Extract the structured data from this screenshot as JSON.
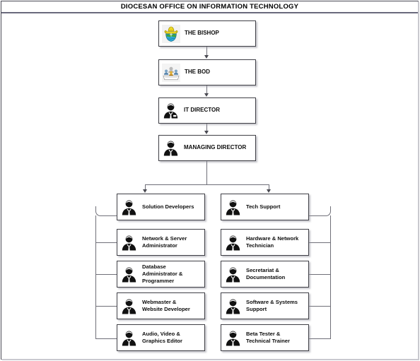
{
  "document": {
    "title": "DIOCESAN OFFICE ON INFORMATION TECHNOLOGY"
  },
  "chain": [
    {
      "id": "bishop",
      "label": "THE BISHOP",
      "icon": "bishop-crest-icon"
    },
    {
      "id": "bod",
      "label": "THE BOD",
      "icon": "board-meeting-icon"
    },
    {
      "id": "itdir",
      "label": "IT DIRECTOR",
      "icon": "person-icon"
    },
    {
      "id": "mdir",
      "label": "MANAGING DIRECTOR",
      "icon": "person-icon"
    }
  ],
  "columns": {
    "left": {
      "head": {
        "label": "Solution Developers",
        "icon": "person-icon"
      },
      "items": [
        {
          "label": "Network & Server\nAdministrator",
          "icon": "person-icon"
        },
        {
          "label": "Database\nAdministrator &\nProgrammer",
          "icon": "person-icon"
        },
        {
          "label": "Webmaster &\nWebsite Developer",
          "icon": "person-icon"
        },
        {
          "label": "Audio, Video &\nGraphics Editor",
          "icon": "person-icon"
        }
      ]
    },
    "right": {
      "head": {
        "label": "Tech Support",
        "icon": "person-icon"
      },
      "items": [
        {
          "label": "Hardware & Network\nTechnician",
          "icon": "person-icon"
        },
        {
          "label": "Secretariat &\nDocumentation",
          "icon": "person-icon"
        },
        {
          "label": "Software & Systems\nSupport",
          "icon": "person-icon"
        },
        {
          "label": "Beta Tester &\nTechnical Trainer",
          "icon": "person-icon"
        }
      ]
    }
  },
  "colors": {
    "frame_border": "#4a4a55",
    "title_rule": "#6a6a7d",
    "node_border": "#3f3f46",
    "connector": "#6f6f78",
    "text": "#0d0d0d",
    "crest_gold": "#e9d21a",
    "crest_blue": "#2aa8d8",
    "crest_green": "#3fa53f"
  }
}
